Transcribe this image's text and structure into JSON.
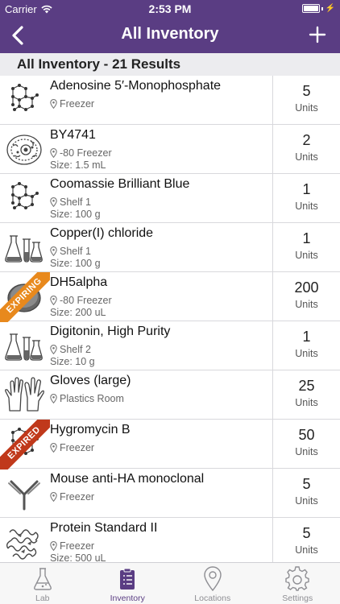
{
  "status": {
    "carrier": "Carrier",
    "time": "2:53 PM"
  },
  "nav": {
    "title": "All Inventory"
  },
  "section": {
    "header": "All Inventory - 21 Results"
  },
  "items": [
    {
      "name": "Adenosine 5′-Monophosphate",
      "location": "Freezer",
      "size": "",
      "quantity": "5",
      "unit": "Units",
      "icon": "molecule-icon",
      "badge": ""
    },
    {
      "name": "BY4741",
      "location": "-80 Freezer",
      "size": "Size: 1.5 mL",
      "quantity": "2",
      "unit": "Units",
      "icon": "cell-icon",
      "badge": ""
    },
    {
      "name": "Coomassie Brilliant Blue",
      "location": "Shelf 1",
      "size": "Size: 100 g",
      "quantity": "1",
      "unit": "Units",
      "icon": "molecule-icon",
      "badge": ""
    },
    {
      "name": "Copper(I) chloride",
      "location": "Shelf 1",
      "size": "Size: 100 g",
      "quantity": "1",
      "unit": "Units",
      "icon": "flask-icon",
      "badge": ""
    },
    {
      "name": "DH5alpha",
      "location": "-80 Freezer",
      "size": "Size: 200 uL",
      "quantity": "200",
      "unit": "Units",
      "icon": "petri-dish-icon",
      "badge": "EXPIRING"
    },
    {
      "name": "Digitonin, High Purity",
      "location": "Shelf 2",
      "size": "Size: 10 g",
      "quantity": "1",
      "unit": "Units",
      "icon": "flask-icon",
      "badge": ""
    },
    {
      "name": "Gloves (large)",
      "location": "Plastics Room",
      "size": "",
      "quantity": "25",
      "unit": "Units",
      "icon": "gloves-icon",
      "badge": ""
    },
    {
      "name": "Hygromycin B",
      "location": "Freezer",
      "size": "",
      "quantity": "50",
      "unit": "Units",
      "icon": "molecule-icon",
      "badge": "EXPIRED"
    },
    {
      "name": "Mouse anti-HA monoclonal",
      "location": "Freezer",
      "size": "",
      "quantity": "5",
      "unit": "Units",
      "icon": "antibody-icon",
      "badge": ""
    },
    {
      "name": "Protein Standard II",
      "location": "Freezer",
      "size": "Size: 500 uL",
      "quantity": "5",
      "unit": "Units",
      "icon": "protein-icon",
      "badge": ""
    }
  ],
  "badge_colors": {
    "EXPIRING": "#e8891d",
    "EXPIRED": "#c0391b"
  },
  "tabs": [
    {
      "label": "Lab",
      "icon": "flask-icon",
      "active": false
    },
    {
      "label": "Inventory",
      "icon": "clipboard-icon",
      "active": true
    },
    {
      "label": "Locations",
      "icon": "map-pin-icon",
      "active": false
    },
    {
      "label": "Settings",
      "icon": "gear-icon",
      "active": false
    }
  ],
  "colors": {
    "brand": "#5a3d83",
    "tab_active": "#5a3d83",
    "tab_inactive": "#8e8e93"
  }
}
